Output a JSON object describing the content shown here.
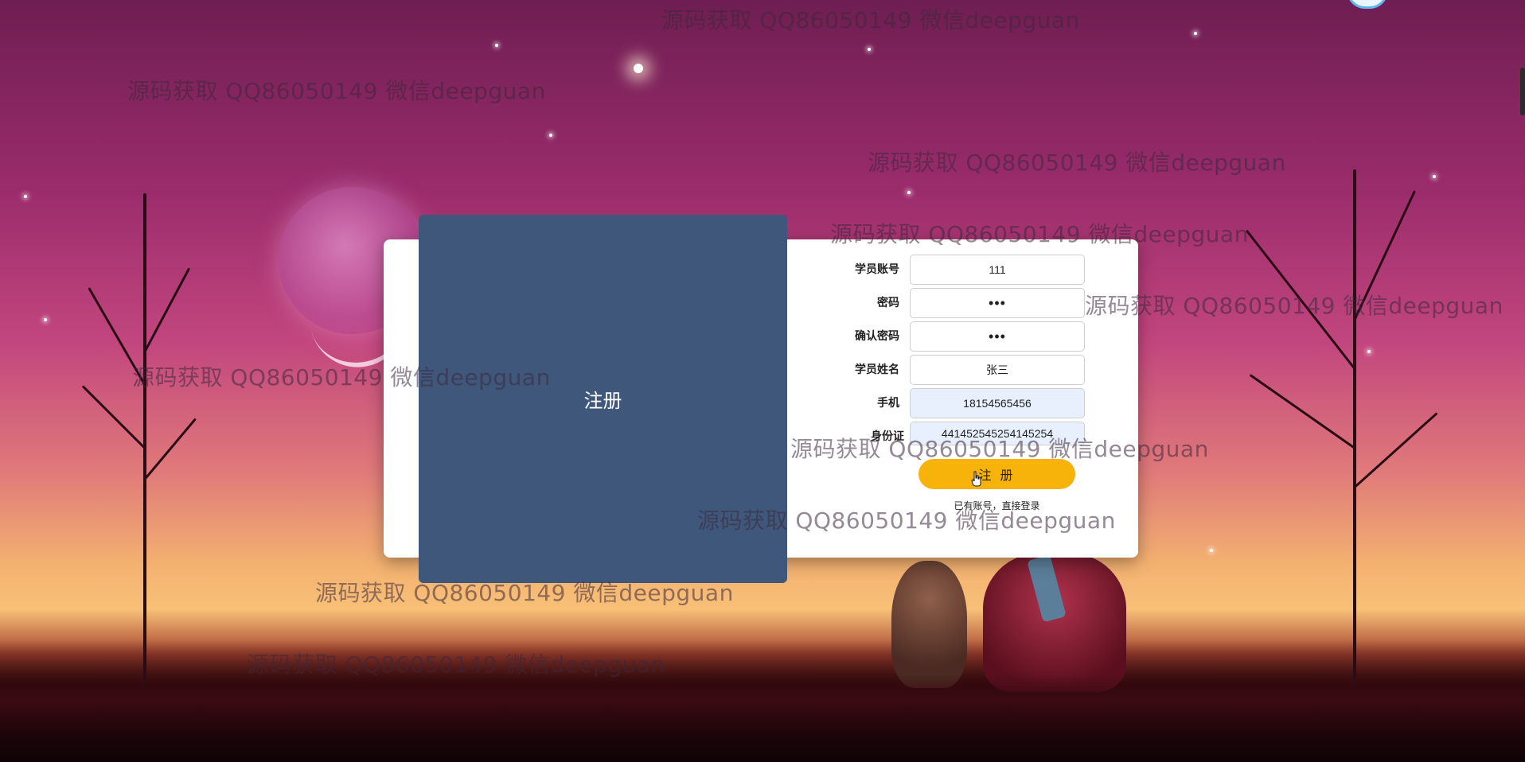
{
  "watermarks": [
    "源码获取 QQ86050149 微信deepguan",
    "源码获取 QQ86050149 微信deepguan",
    "源码获取 QQ86050149 微信deepguan",
    "源码获取 QQ86050149 微信deepguan",
    "源码获取 QQ86050149 微信deepguan",
    "源码获取 QQ86050149 微信deepguan",
    "源码获取 QQ86050149 微信deepguan",
    "源码获取 QQ86050149 微信deepguan",
    "源码获取 QQ86050149 微信deepguan",
    "源码获取 QQ86050149 微信deepguan"
  ],
  "overlay": {
    "title": "注册"
  },
  "form": {
    "account": {
      "label": "学员账号",
      "value": "111"
    },
    "password": {
      "label": "密码",
      "value": "•••"
    },
    "confirm_password": {
      "label": "确认密码",
      "value": "•••"
    },
    "name": {
      "label": "学员姓名",
      "value": "张三"
    },
    "phone": {
      "label": "手机",
      "value": "18154565456"
    },
    "id_card": {
      "label": "身份证",
      "value": "441452545254145254"
    },
    "submit_label": "注 册",
    "login_link": "已有账号，直接登录"
  }
}
